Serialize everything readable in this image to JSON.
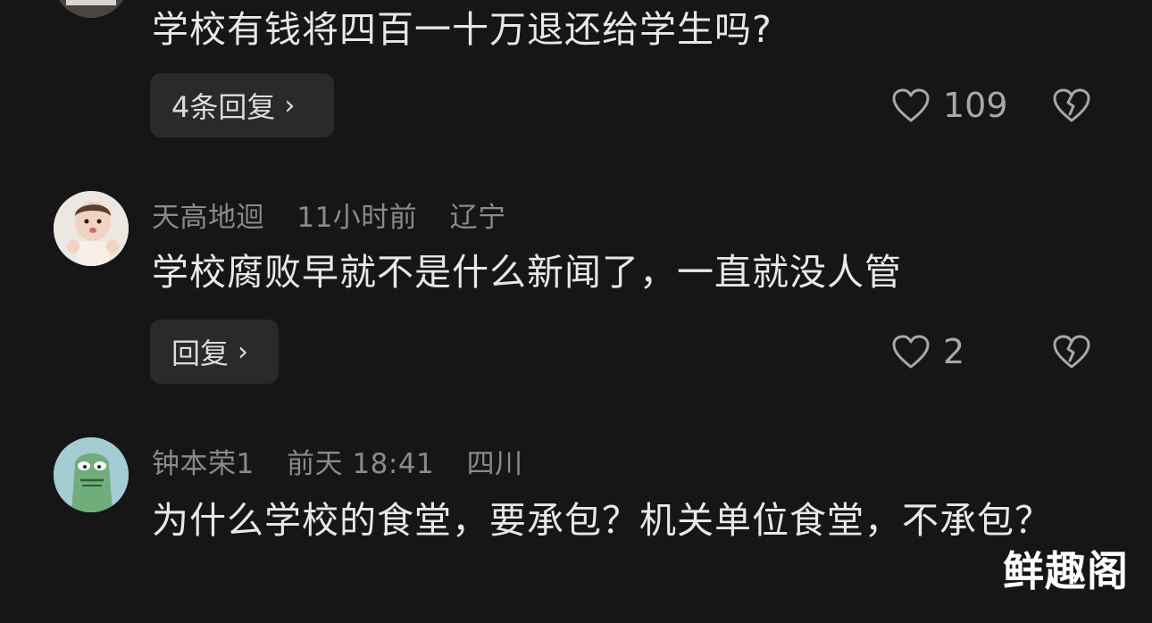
{
  "comments": [
    {
      "user": "",
      "time": "",
      "location": "",
      "text": "学校有钱将四百一十万退还给学生吗?",
      "reply_label": "4条回复",
      "likes": "109"
    },
    {
      "user": "天高地迴",
      "time": "11小时前",
      "location": "辽宁",
      "text": "学校腐败早就不是什么新闻了，一直就没人管",
      "reply_label": "回复",
      "likes": "2"
    },
    {
      "user": "钟本荣1",
      "time": "前天 18:41",
      "location": "四川",
      "text": "为什么学校的食堂，要承包？机关单位食堂，不承包？",
      "reply_label": "",
      "likes": ""
    }
  ],
  "icons": {
    "like": "heart-outline-icon",
    "dislike": "broken-heart-icon",
    "chevron": "chevron-right-icon"
  },
  "watermark": "鲜趣阁",
  "colors": {
    "background": "#161617",
    "text": "#e8e8ea",
    "meta": "#8a8a8c",
    "button_bg": "#2a2a2c"
  }
}
